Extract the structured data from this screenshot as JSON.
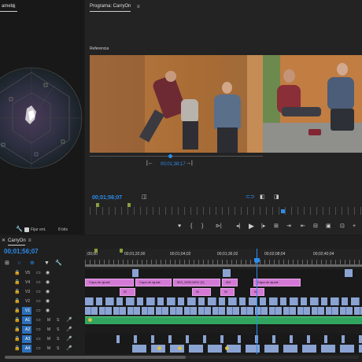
{
  "source_panel": {
    "tab_label": "ametri",
    "fijar_label": "Fijar ent.",
    "bits_label": "8 bits"
  },
  "program_monitor": {
    "tab_label": "Programa: CarryOn",
    "reference_label": "Referencia",
    "ref_timecode": "00;01;38;17",
    "timecode": "00;01;56;07"
  },
  "timeline": {
    "tab_label": "CarryOn",
    "timecode": "00;01;56;07",
    "ruler_labels": [
      ";00;00",
      "00;01;32;00",
      "00;01;04;02",
      "00;01;36;02",
      "00;02;08;04",
      "00;02;40;04"
    ],
    "tracks": [
      {
        "name": "V5",
        "toggle": "V1"
      },
      {
        "name": "V4",
        "toggle": "V1"
      },
      {
        "name": "V3",
        "toggle": "V1"
      },
      {
        "name": "V2",
        "toggle": "V1"
      },
      {
        "name": "V1",
        "toggle": "V1"
      },
      {
        "name": "A1",
        "toggle": "A1"
      },
      {
        "name": "A2",
        "toggle": "A1"
      },
      {
        "name": "A3",
        "toggle": "A1"
      },
      {
        "name": "A4",
        "toggle": "A1"
      }
    ],
    "track_buttons": {
      "mute": "M",
      "solo": "S"
    },
    "clips": {
      "adjust": "Capa de ajuste",
      "adjust_short": "fx",
      "clip_mid": "MVI_0000.MOV [V]",
      "clip_avi": "AVI",
      "w_label": "W"
    }
  },
  "colors": {
    "accent": "#2d8ceb",
    "adjustment": "#d47ad6",
    "video": "#8aa3d2",
    "audio": "#31a560"
  }
}
